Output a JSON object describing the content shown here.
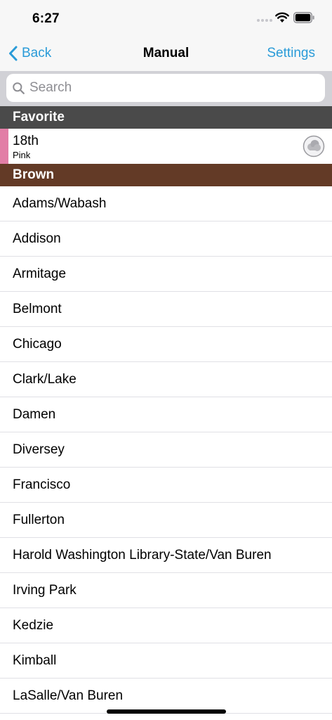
{
  "status_bar": {
    "time": "6:27"
  },
  "nav": {
    "back_label": "Back",
    "title": "Manual",
    "settings_label": "Settings"
  },
  "search": {
    "placeholder": "Search",
    "value": ""
  },
  "sections": {
    "favorite": "Favorite",
    "brown": "Brown"
  },
  "favorite": {
    "name": "18th",
    "line": "Pink",
    "line_color": "#e27ea6",
    "status_icon": "cloud-icon"
  },
  "stations": [
    "Adams/Wabash",
    "Addison",
    "Armitage",
    "Belmont",
    "Chicago",
    "Clark/Lake",
    "Damen",
    "Diversey",
    "Francisco",
    "Fullerton",
    "Harold Washington Library-State/Van Buren",
    "Irving Park",
    "Kedzie",
    "Kimball",
    "LaSalle/Van Buren"
  ],
  "colors": {
    "accent": "#2a9bd8",
    "favorite_header": "#4a4a4a",
    "brown_line": "#633a26",
    "pink_line": "#e27ea6"
  }
}
